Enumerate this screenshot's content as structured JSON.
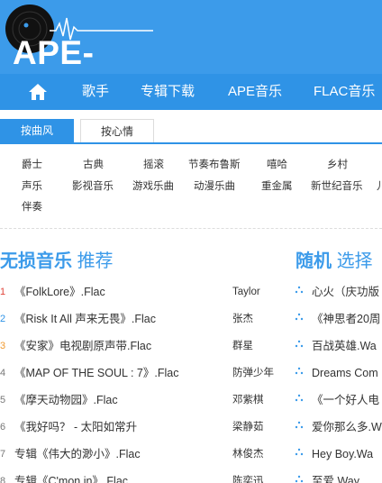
{
  "logo": {
    "text": "APE-FLAC"
  },
  "nav": {
    "home_icon": "home-icon",
    "items": [
      "歌手",
      "专辑下载",
      "APE音乐",
      "FLAC音乐"
    ]
  },
  "tabs": {
    "active": "按曲风",
    "inactive": "按心情"
  },
  "genres": [
    [
      "爵士",
      "古典",
      "摇滚",
      "节奏布鲁斯",
      "嘻哈",
      "乡村"
    ],
    [
      "声乐",
      "影视音乐",
      "游戏乐曲",
      "动漫乐曲",
      "重金属",
      "新世纪音乐",
      "儿"
    ],
    [
      "伴奏"
    ]
  ],
  "section_left": {
    "title_bold": "无损音乐",
    "title_light": "推荐"
  },
  "section_right": {
    "title_bold": "随机",
    "title_light": "选择"
  },
  "colors": {
    "header": "#3c9bea",
    "nav": "#2f93e6",
    "rank_red": "#e0443a",
    "rank_blue": "#2f93e6",
    "rank_orange": "#f19a30"
  },
  "list": [
    {
      "rank": "1",
      "title": "《FolkLore》.Flac",
      "artist": "Taylor",
      "random": "心火（庆功版"
    },
    {
      "rank": "2",
      "title": "《Risk It All 声来无畏》.Flac",
      "artist": "张杰",
      "random": "《神思者20周"
    },
    {
      "rank": "3",
      "title": "《安家》电视剧原声带.Flac",
      "artist": "群星",
      "random": "百战英雄.Wa"
    },
    {
      "rank": "4",
      "title": "《MAP OF THE SOUL : 7》.Flac",
      "artist": "防弹少年",
      "random": "Dreams Com"
    },
    {
      "rank": "5",
      "title": "《摩天动物园》.Flac",
      "artist": "邓紫棋",
      "random": "《一个好人电"
    },
    {
      "rank": "6",
      "title": "《我好吗？ - 太阳如常升",
      "artist": "梁静茹",
      "random": "爱你那么多.W"
    },
    {
      "rank": "7",
      "title": "专辑《伟大的渺小》.Flac",
      "artist": "林俊杰",
      "random": "Hey Boy.Wa"
    },
    {
      "rank": "8",
      "title": "专辑《C'mon in》.Flac",
      "artist": "陈奕迅",
      "random": "至爱.Way"
    }
  ]
}
